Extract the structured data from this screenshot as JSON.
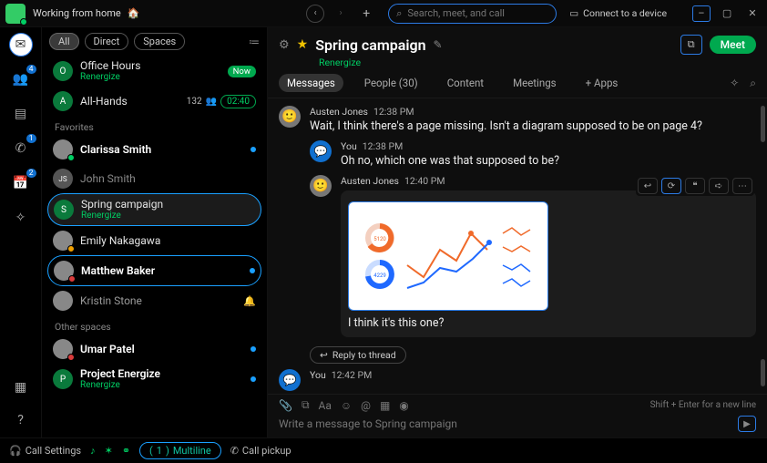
{
  "topbar": {
    "status_text": "Working from home",
    "status_emoji": "🏠",
    "search_placeholder": "Search, meet, and call",
    "connect_label": "Connect to a device"
  },
  "rail": {
    "items": [
      {
        "name": "messaging",
        "badge": ""
      },
      {
        "name": "teams",
        "badge": "4"
      },
      {
        "name": "contacts",
        "badge": ""
      },
      {
        "name": "calling",
        "badge": "1"
      },
      {
        "name": "meetings",
        "badge": "2"
      },
      {
        "name": "navigation",
        "badge": ""
      }
    ]
  },
  "filters": {
    "all": "All",
    "direct": "Direct",
    "spaces": "Spaces"
  },
  "sidebar": {
    "rows": [
      {
        "avatar_letter": "O",
        "name": "Office Hours",
        "sub": "Renergize",
        "pill": "Now"
      },
      {
        "avatar_letter": "A",
        "name": "All-Hands",
        "count": "132",
        "icon": "👥",
        "time": "02:40"
      }
    ],
    "section_fav": "Favorites",
    "favorites": [
      {
        "name": "Clarissa Smith",
        "bold": true,
        "dot": true
      },
      {
        "avatar_letter": "JS",
        "name": "John Smith"
      },
      {
        "avatar_letter": "S",
        "name": "Spring campaign",
        "sub": "Renergize",
        "selected": true
      },
      {
        "name": "Emily Nakagawa"
      },
      {
        "name": "Matthew Baker",
        "bold": true,
        "dot": true,
        "selected2": true
      },
      {
        "name": "Kristin Stone",
        "bell": true
      }
    ],
    "section_other": "Other spaces",
    "other": [
      {
        "name": "Umar Patel",
        "bold": true,
        "dot": true
      },
      {
        "avatar_letter": "P",
        "name": "Project Energize",
        "sub": "Renergize",
        "bold": true,
        "dot": true
      }
    ]
  },
  "space": {
    "title": "Spring campaign",
    "org": "Renergize",
    "meet": "Meet",
    "tabs": {
      "messages": "Messages",
      "people": "People (30)",
      "content": "Content",
      "meetings": "Meetings",
      "apps": "+  Apps"
    }
  },
  "messages": [
    {
      "who": "Austen Jones",
      "time": "12:38 PM",
      "text": "Wait, I think there's a page missing. Isn't a diagram supposed to be on page 4?"
    },
    {
      "who": "You",
      "time": "12:38 PM",
      "text": "Oh no, which one was that supposed to be?",
      "self": true,
      "indent": true
    },
    {
      "who": "Austen Jones",
      "time": "12:40 PM",
      "text": "I think it's this one?",
      "attachment": true,
      "indent": true
    },
    {
      "who": "You",
      "time": "12:42 PM",
      "self": true
    }
  ],
  "reply_label": "Reply to thread",
  "composer": {
    "hint": "Shift + Enter for a new line",
    "placeholder": "Write a message to Spring campaign"
  },
  "bottombar": {
    "call_settings": "Call Settings",
    "multiline": "Multiline",
    "multiline_badge": "1",
    "call_pickup": "Call pickup"
  },
  "chart_data": {
    "type": "composite",
    "donuts": [
      {
        "color": "#f06a2a",
        "value": 5120,
        "percent": 82
      },
      {
        "color": "#1f69ff",
        "value": 4229,
        "percent": 72
      }
    ],
    "lines_main": [
      {
        "name": "series-a",
        "color": "#f06a2a",
        "points": [
          [
            0,
            55
          ],
          [
            18,
            40
          ],
          [
            36,
            72
          ],
          [
            54,
            58
          ],
          [
            70,
            88
          ],
          [
            88,
            68
          ]
        ]
      },
      {
        "name": "series-b",
        "color": "#1f69ff",
        "points": [
          [
            0,
            28
          ],
          [
            18,
            34
          ],
          [
            36,
            50
          ],
          [
            54,
            46
          ],
          [
            72,
            60
          ],
          [
            90,
            78
          ]
        ]
      }
    ],
    "lines_small": [
      {
        "color": "#f06a2a",
        "points": [
          [
            0,
            6
          ],
          [
            10,
            2
          ],
          [
            20,
            8
          ],
          [
            30,
            4
          ]
        ]
      },
      {
        "color": "#f06a2a",
        "points": [
          [
            0,
            0
          ],
          [
            10,
            5
          ],
          [
            20,
            2
          ],
          [
            30,
            6
          ]
        ]
      },
      {
        "color": "#1f69ff",
        "points": [
          [
            0,
            3
          ],
          [
            10,
            7
          ],
          [
            20,
            4
          ],
          [
            30,
            8
          ]
        ]
      },
      {
        "color": "#1f69ff",
        "points": [
          [
            0,
            7
          ],
          [
            10,
            3
          ],
          [
            20,
            8
          ],
          [
            30,
            5
          ]
        ]
      }
    ]
  }
}
